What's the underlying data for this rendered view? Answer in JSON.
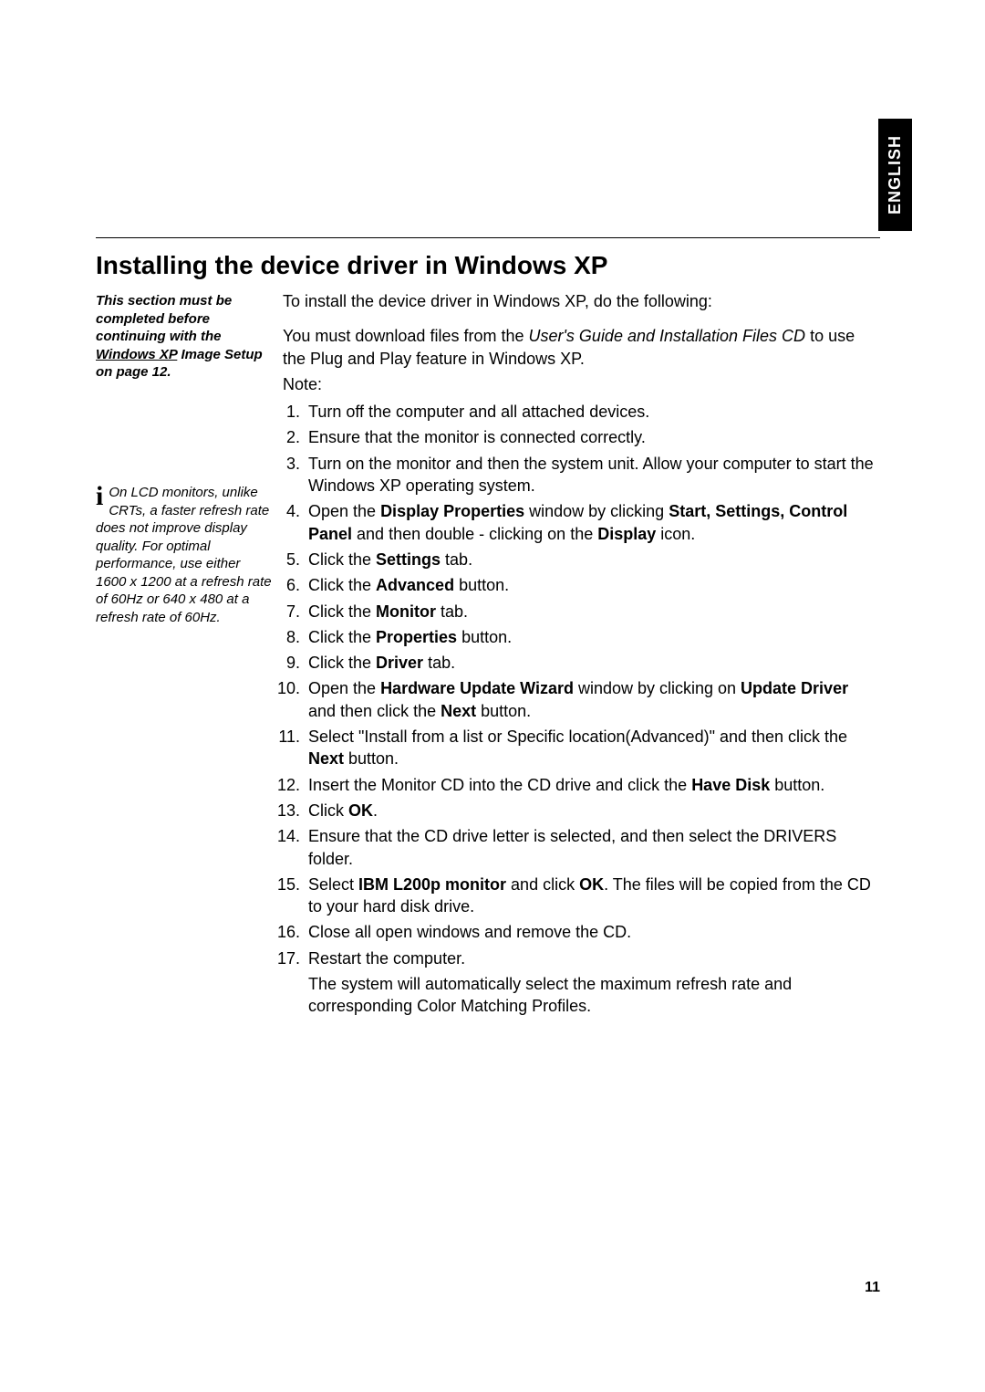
{
  "language_tab": "ENGLISH",
  "heading": "Installing the device driver in Windows XP",
  "sidebar_note1": {
    "line1": "This section must be completed before continuing with the ",
    "underline": "Windows XP",
    "after_underline": " Image Setup on page 12."
  },
  "sidebar_note2": "On LCD monitors, unlike CRTs, a faster refresh rate does not improve display quality. For optimal performance, use either 1600 x 1200 at a refresh rate of 60Hz or 640 x 480 at a refresh rate of 60Hz.",
  "intro1": "To install the device driver in Windows XP, do the following:",
  "intro2_a": "You must download files from the ",
  "intro2_italic": "User's Guide and Installation Files CD",
  "intro2_b": " to use the Plug and Play feature in Windows XP.",
  "note_label": "Note:",
  "steps": {
    "s1": "Turn off the computer and all attached devices.",
    "s2": "Ensure that the monitor is connected correctly.",
    "s3": "Turn on the monitor and then the system unit. Allow your computer to start the Windows XP operating system.",
    "s4_a": "Open the ",
    "s4_b1": "Display Properties",
    "s4_b": " window by clicking ",
    "s4_b2": "Start, Settings, Control Panel",
    "s4_c": " and then double - clicking on the ",
    "s4_b3": "Display",
    "s4_d": " icon.",
    "s5_a": "Click the ",
    "s5_b": "Settings",
    "s5_c": " tab.",
    "s6_a": "Click the ",
    "s6_b": "Advanced",
    "s6_c": " button.",
    "s7_a": "Click the ",
    "s7_b": "Monitor",
    "s7_c": " tab.",
    "s8_a": "Click the ",
    "s8_b": "Properties",
    "s8_c": " button.",
    "s9_a": "Click the ",
    "s9_b": "Driver",
    "s9_c": " tab.",
    "s10_a": "Open the ",
    "s10_b1": "Hardware Update Wizard",
    "s10_b": " window by clicking on ",
    "s10_b2": "Update Driver",
    "s10_c": " and then click the ",
    "s10_b3": "Next",
    "s10_d": " button.",
    "s11_a": "Select \"Install from a list or Specific location(Advanced)\" and then click the ",
    "s11_b": "Next",
    "s11_c": " button.",
    "s12_a": "Insert the Monitor CD into the CD drive and click the ",
    "s12_b": "Have Disk",
    "s12_c": " button.",
    "s13_a": "Click ",
    "s13_b": "OK",
    "s13_c": ".",
    "s14": "Ensure that the CD drive letter is selected, and then select the DRIVERS folder.",
    "s15_a": "Select ",
    "s15_b1": "IBM L200p monitor",
    "s15_b": " and click ",
    "s15_b2": "OK",
    "s15_c": ". The files will be copied from the CD to your hard disk drive.",
    "s16": "Close all open windows and remove the CD.",
    "s17": "Restart the computer.",
    "s17_sub": "The system will automatically select the maximum refresh rate and corresponding Color Matching Profiles."
  },
  "page_number": "11"
}
